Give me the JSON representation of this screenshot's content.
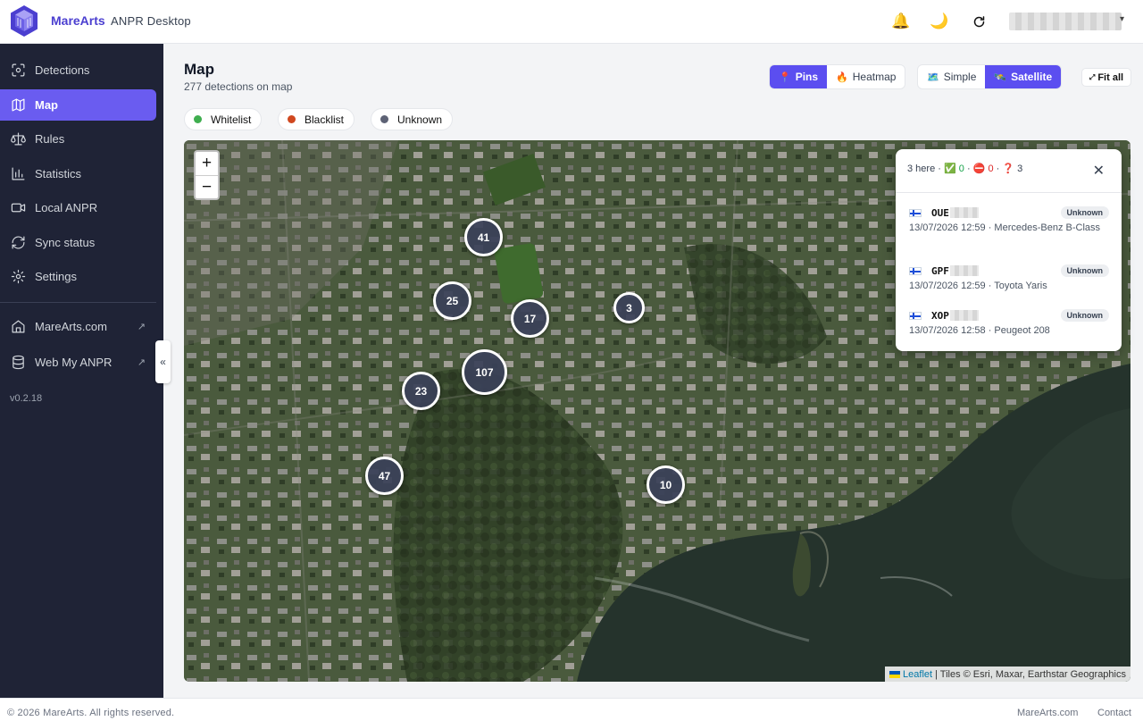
{
  "app": {
    "brand": "MareArts",
    "subtitle": "ANPR Desktop",
    "version": "v0.2.18"
  },
  "header_icons": [
    "bell-icon",
    "moon-icon",
    "refresh-icon"
  ],
  "sidebar": {
    "items": [
      {
        "label": "Detections",
        "icon": "scan-icon",
        "active": false
      },
      {
        "label": "Map",
        "icon": "map-icon",
        "active": true
      },
      {
        "label": "Rules",
        "icon": "scale-icon",
        "active": false
      },
      {
        "label": "Statistics",
        "icon": "bar-chart-icon",
        "active": false
      },
      {
        "label": "Local ANPR",
        "icon": "camera-icon",
        "active": false
      },
      {
        "label": "Sync status",
        "icon": "sync-icon",
        "active": false
      },
      {
        "label": "Settings",
        "icon": "gear-icon",
        "active": false
      }
    ],
    "links": [
      {
        "label": "MareArts.com",
        "icon": "home-icon"
      },
      {
        "label": "Web My ANPR",
        "icon": "database-icon"
      }
    ],
    "collapse_glyph": "«"
  },
  "page": {
    "title": "Map",
    "subtitle": "277 detections on map"
  },
  "view_modes": [
    {
      "label": "Pins",
      "icon": "📍",
      "active": true
    },
    {
      "label": "Heatmap",
      "icon": "🔥",
      "active": false
    }
  ],
  "tile_modes": [
    {
      "label": "Simple",
      "icon": "🗺️",
      "active": false
    },
    {
      "label": "Satellite",
      "icon": "🛰️",
      "active": true
    }
  ],
  "fit_all": {
    "icon": "⤢",
    "label": "Fit all"
  },
  "filters": [
    {
      "label": "Whitelist",
      "color": "#3fae4f"
    },
    {
      "label": "Blacklist",
      "color": "#d0481f"
    },
    {
      "label": "Unknown",
      "color": "#5d6275"
    }
  ],
  "map": {
    "zoom_in": "+",
    "zoom_out": "−",
    "clusters": [
      "41",
      "25",
      "17",
      "3",
      "107",
      "23",
      "47",
      "10"
    ],
    "attribution": {
      "leaflet": "Leaflet",
      "tiles": "| Tiles © Esri, Maxar, Earthstar Geographics"
    }
  },
  "popup": {
    "count_text": "3 here ·",
    "ok_icon": "✅",
    "ok_count": "0",
    "sep1": "·",
    "block_icon": "⛔",
    "block_count": "0",
    "sep2": "·",
    "unknown_icon": "❓",
    "unknown_count": "3",
    "close": "✕",
    "detections": [
      {
        "plate": "OUE",
        "status": "Unknown",
        "when": "13/07/2026 12:59 · Mercedes-Benz B-Class"
      },
      {
        "plate": "GPF",
        "status": "Unknown",
        "when": "13/07/2026 12:59 · Toyota Yaris"
      },
      {
        "plate": "XOP",
        "status": "Unknown",
        "when": "13/07/2026 12:58 · Peugeot 208"
      }
    ]
  },
  "footer": {
    "copyright": "© 2026 MareArts. All rights reserved.",
    "links": [
      "MareArts.com",
      "Contact"
    ]
  }
}
